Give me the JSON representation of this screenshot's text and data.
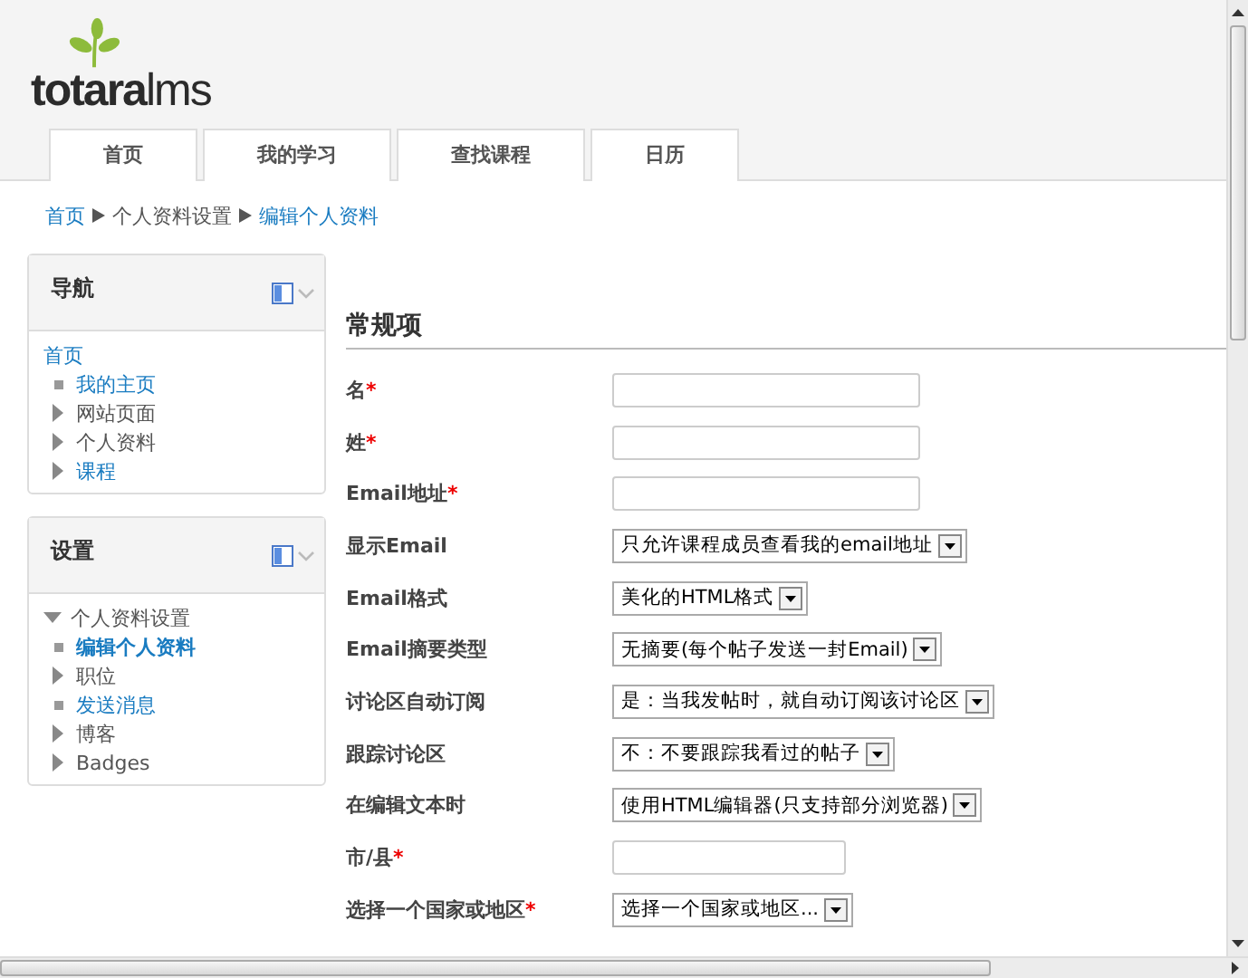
{
  "logo": {
    "name": "totara",
    "suffix": "lms"
  },
  "nav_tabs": [
    {
      "label": "首页"
    },
    {
      "label": "我的学习"
    },
    {
      "label": "查找课程"
    },
    {
      "label": "日历"
    }
  ],
  "breadcrumb": [
    {
      "label": "首页",
      "link": true
    },
    {
      "label": "个人资料设置",
      "link": false
    },
    {
      "label": "编辑个人资料",
      "link": true
    }
  ],
  "blocks": [
    {
      "title": "导航",
      "items": [
        {
          "label": "首页",
          "kind": "root",
          "link": true,
          "current": false,
          "children": [
            {
              "label": "我的主页",
              "kind": "leaf",
              "link": true,
              "current": false
            },
            {
              "label": "网站页面",
              "kind": "branch",
              "expanded": false,
              "link": false,
              "current": false
            },
            {
              "label": "个人资料",
              "kind": "branch",
              "expanded": false,
              "link": false,
              "current": false
            },
            {
              "label": "课程",
              "kind": "branch",
              "expanded": false,
              "link": true,
              "current": false
            }
          ]
        }
      ]
    },
    {
      "title": "设置",
      "items": [
        {
          "label": "个人资料设置",
          "kind": "branch",
          "expanded": true,
          "link": false,
          "current": false,
          "children": [
            {
              "label": "编辑个人资料",
              "kind": "leaf",
              "link": true,
              "current": true
            },
            {
              "label": "职位",
              "kind": "branch",
              "expanded": false,
              "link": false,
              "current": false
            },
            {
              "label": "发送消息",
              "kind": "leaf",
              "link": true,
              "current": false
            },
            {
              "label": "博客",
              "kind": "branch",
              "expanded": false,
              "link": false,
              "current": false
            },
            {
              "label": "Badges",
              "kind": "branch",
              "expanded": false,
              "link": false,
              "current": false
            }
          ]
        }
      ]
    }
  ],
  "form": {
    "section_title": "常规项",
    "fields": [
      {
        "label": "名",
        "required": true,
        "required_mark": "*",
        "kind": "text",
        "short": false
      },
      {
        "label": "姓",
        "required": true,
        "required_mark": "*",
        "kind": "text",
        "short": false
      },
      {
        "label": "Email地址",
        "required": true,
        "required_mark": "*",
        "kind": "text",
        "short": false
      },
      {
        "label": "显示Email",
        "kind": "select",
        "value": "只允许课程成员查看我的email地址"
      },
      {
        "label": "Email格式",
        "kind": "select",
        "value": "美化的HTML格式"
      },
      {
        "label": "Email摘要类型",
        "kind": "select",
        "value": "无摘要(每个帖子发送一封Email)"
      },
      {
        "label": "讨论区自动订阅",
        "kind": "select",
        "value": "是：当我发帖时，就自动订阅该讨论区"
      },
      {
        "label": "跟踪讨论区",
        "kind": "select",
        "value": "不：不要跟踪我看过的帖子"
      },
      {
        "label": "在编辑文本时",
        "kind": "select",
        "value": "使用HTML编辑器(只支持部分浏览器)"
      },
      {
        "label": "市/县",
        "required": true,
        "required_mark": "*",
        "kind": "text",
        "short": true
      },
      {
        "label": "选择一个国家或地区",
        "required": true,
        "required_mark": "*",
        "kind": "select",
        "value": "选择一个国家或地区..."
      }
    ]
  }
}
